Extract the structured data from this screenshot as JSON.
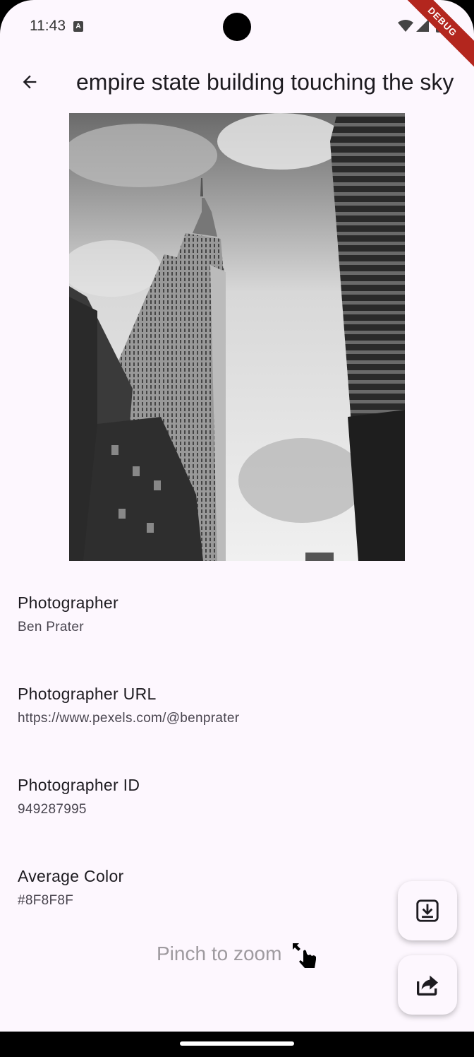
{
  "status": {
    "time": "11:43",
    "a_badge": "A",
    "debug_label": "DEBUG"
  },
  "app_bar": {
    "title": "empire  state building touching the sky"
  },
  "photo": {
    "average_color": "#8F8F8F"
  },
  "details": [
    {
      "label": "Photographer",
      "value": "Ben Prater"
    },
    {
      "label": "Photographer URL",
      "value": "https://www.pexels.com/@benprater"
    },
    {
      "label": "Photographer ID",
      "value": "949287995"
    },
    {
      "label": "Average Color",
      "value": "#8F8F8F"
    }
  ],
  "hint": {
    "text": "Pinch to zoom",
    "icon": "pinch-hand-icon"
  },
  "actions": {
    "download_icon": "download-icon",
    "share_icon": "share-icon"
  }
}
